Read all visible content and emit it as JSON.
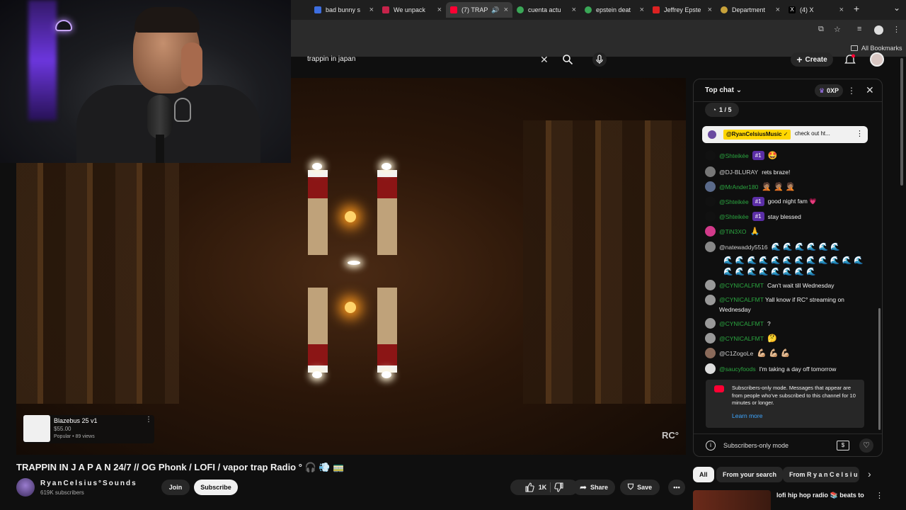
{
  "browser": {
    "tabs": [
      {
        "title": "bad bunny s",
        "color": "#3d6ee0",
        "active": false
      },
      {
        "title": "We unpack",
        "color": "#c6234a",
        "active": false
      },
      {
        "title": "(7) TRAP",
        "color": "#ff0033",
        "active": true
      },
      {
        "title": "cuenta actu",
        "color": "#3aa757",
        "active": false
      },
      {
        "title": "epstein deat",
        "color": "#3aa757",
        "active": false
      },
      {
        "title": "Jeffrey Epste",
        "color": "#d22",
        "active": false
      },
      {
        "title": "Department",
        "color": "#c8a23a",
        "active": false
      },
      {
        "title": "(4) X",
        "color": "#000000",
        "active": false
      }
    ],
    "all_bookmarks": "All Bookmarks"
  },
  "search": {
    "query": "trappin in japan",
    "clear_icon": "close-icon",
    "search_icon": "search-icon",
    "mic_icon": "mic-icon"
  },
  "header": {
    "create_label": "Create",
    "bell_icon": "bell-icon"
  },
  "video": {
    "watermark": "RC°",
    "shelf": {
      "title": "Blazebus 25 v1",
      "price": "$55.00",
      "meta": "Popular • 89 views"
    }
  },
  "watch": {
    "title": "TRAPPIN IN  J A P A N  24/7 // OG Phonk / LOFI / vapor trap Radio ° 🎧 💨 🚃",
    "channel_name": "RyanCelsius°Sounds",
    "subscribers": "619K subscribers",
    "join_label": "Join",
    "subscribe_label": "Subscribe",
    "like_count": "1K",
    "share_label": "Share",
    "save_label": "Save"
  },
  "chat": {
    "mode_label": "Top chat",
    "xp_label": "0XP",
    "poll_label": "1 / 5",
    "pinned": {
      "name": "@RyanCelsiusMusic ✓",
      "text": "check out ht..."
    },
    "messages": [
      {
        "name": "@Shteikée",
        "badge": "#1",
        "text": "🤩",
        "avatar": "#111111",
        "member": true
      },
      {
        "name": "@DJ-BLURAY",
        "badge": "",
        "text": "rets braze!",
        "avatar": "#777777",
        "member": false
      },
      {
        "name": "@MrAnder180",
        "badge": "",
        "text": "🤦🏽 🤦🏽 🤦🏽",
        "avatar": "#5a6a8a",
        "member": true
      },
      {
        "name": "@Shteikée",
        "badge": "#1",
        "text": "good night fam 💗",
        "avatar": "#111111",
        "member": true
      },
      {
        "name": "@Shteikée",
        "badge": "#1",
        "text": "stay blessed",
        "avatar": "#111111",
        "member": true
      },
      {
        "name": "@TiN3XO",
        "badge": "",
        "text": "🙏",
        "avatar": "#d23a8a",
        "member": true
      },
      {
        "name": "@natewaddy5516",
        "badge": "",
        "text": "🌊 🌊 🌊 🌊 🌊 🌊",
        "avatar": "#888888",
        "member": false
      },
      {
        "name": "@CYNICALFMT",
        "badge": "",
        "text": "Can't wait till Wednesday",
        "avatar": "#999999",
        "member": true
      },
      {
        "name": "@CYNICALFMT",
        "badge": "",
        "text": "Yall know if RC° streaming on Wednesday",
        "avatar": "#999999",
        "member": true
      },
      {
        "name": "@CYNICALFMT",
        "badge": "",
        "text": "?",
        "avatar": "#999999",
        "member": true
      },
      {
        "name": "@CYNICALFMT",
        "badge": "",
        "text": "🤔",
        "avatar": "#999999",
        "member": true
      },
      {
        "name": "@C1ZogoLe",
        "badge": "",
        "text": "💪🏼 💪🏼 💪🏼",
        "avatar": "#8a6a5a",
        "member": false
      },
      {
        "name": "@saucyfoods",
        "badge": "",
        "text": "I'm taking a day off tomorrow",
        "avatar": "#dddddd",
        "member": true
      }
    ],
    "wave_rows": "🌊 🌊 🌊 🌊 🌊 🌊 🌊 🌊 🌊 🌊 🌊 🌊 🌊 🌊 🌊 🌊 🌊 🌊 🌊 🌊",
    "notice_text": "Subscribers-only mode. Messages that appear are from people who've subscribed to this channel for 10 minutes or longer.",
    "notice_link": "Learn more",
    "footer_text": "Subscribers-only mode"
  },
  "filters": {
    "chips": [
      "All",
      "From your search",
      "From R y a n C e l s i u"
    ]
  },
  "recommendation": {
    "title": "lofi hip hop radio 📚 beats to"
  }
}
